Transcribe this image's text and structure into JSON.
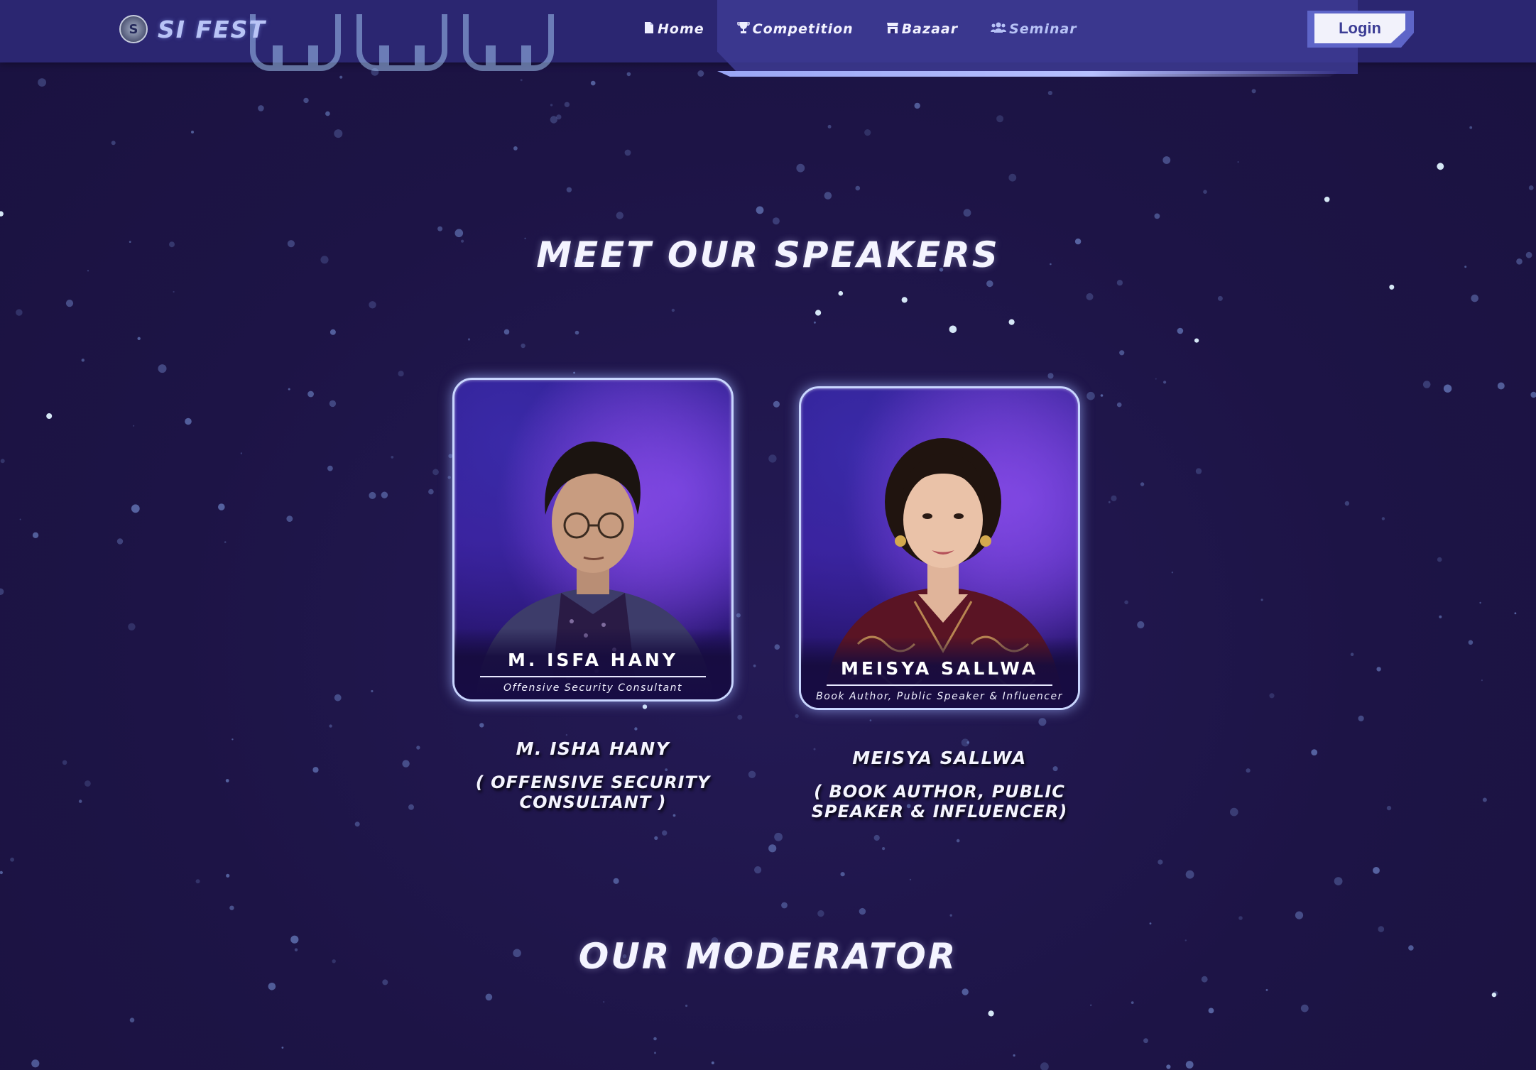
{
  "nav": {
    "brand": "SI FEST",
    "links": [
      {
        "label": "Home",
        "icon": "file-icon"
      },
      {
        "label": "Competition",
        "icon": "trophy-icon"
      },
      {
        "label": "Bazaar",
        "icon": "store-icon"
      },
      {
        "label": "Seminar",
        "icon": "users-icon"
      }
    ],
    "login_label": "Login"
  },
  "colors": {
    "background": "#1e1548",
    "navbar": "#2b2671",
    "accent": "#b7c2f6",
    "login_text": "#3c3d95"
  },
  "speakers_section": {
    "title": "MEET OUR SPEAKERS",
    "speakers": [
      {
        "card_name": "M. ISFA HANY",
        "card_role": "Offensive Security Consultant",
        "name": "M. ISHA HANY",
        "role": "( OFFENSIVE SECURITY CONSULTANT )"
      },
      {
        "card_name": "MEISYA SALLWA",
        "card_role": "Book Author, Public Speaker & Influencer",
        "name": "MEISYA SALLWA",
        "role": "( BOOK AUTHOR, PUBLIC SPEAKER & INFLUENCER)"
      }
    ]
  },
  "moderator_section": {
    "title": "OUR MODERATOR"
  }
}
